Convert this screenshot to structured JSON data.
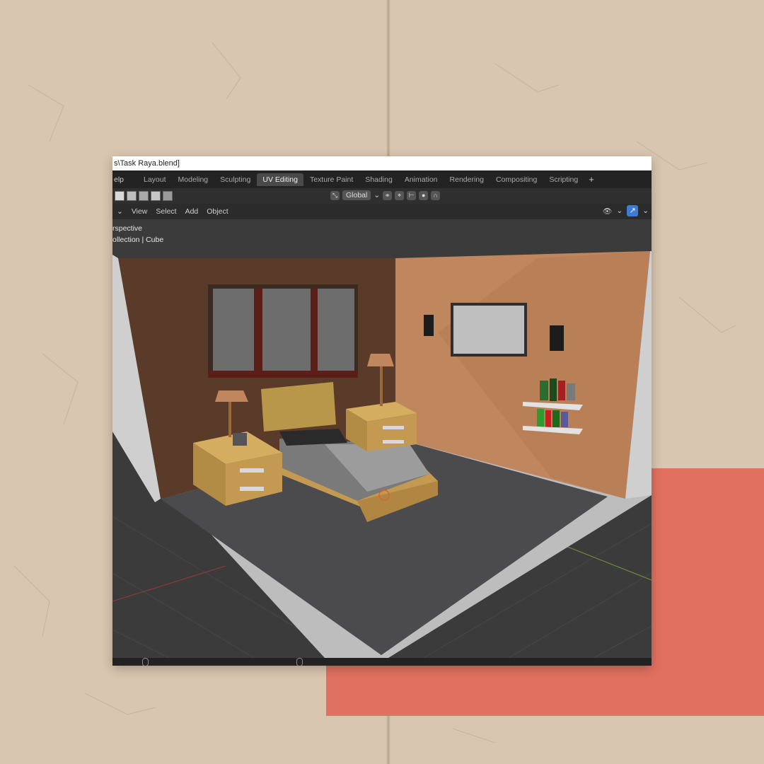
{
  "window": {
    "title": "s\\Task Raya.blend]"
  },
  "menu": {
    "help": "elp"
  },
  "workspaces": [
    {
      "label": "Layout",
      "active": false
    },
    {
      "label": "Modeling",
      "active": false
    },
    {
      "label": "Sculpting",
      "active": false
    },
    {
      "label": "UV Editing",
      "active": true
    },
    {
      "label": "Texture Paint",
      "active": false
    },
    {
      "label": "Shading",
      "active": false
    },
    {
      "label": "Animation",
      "active": false
    },
    {
      "label": "Rendering",
      "active": false
    },
    {
      "label": "Compositing",
      "active": false
    },
    {
      "label": "Scripting",
      "active": false
    }
  ],
  "add_workspace": "+",
  "toolbar": {
    "transform_orientation": "Global"
  },
  "header": {
    "view": "View",
    "select": "Select",
    "add": "Add",
    "object": "Object"
  },
  "viewport": {
    "mode_label": "rspective",
    "collection_label": "ollection | Cube"
  },
  "colors": {
    "accent_red_card": "#e07060",
    "active_tab": "#4a4a4a",
    "wall_left": "#5a3a28",
    "wall_right": "#c0875e",
    "floor": "#4a4a4c",
    "wood": "#c49a52"
  }
}
